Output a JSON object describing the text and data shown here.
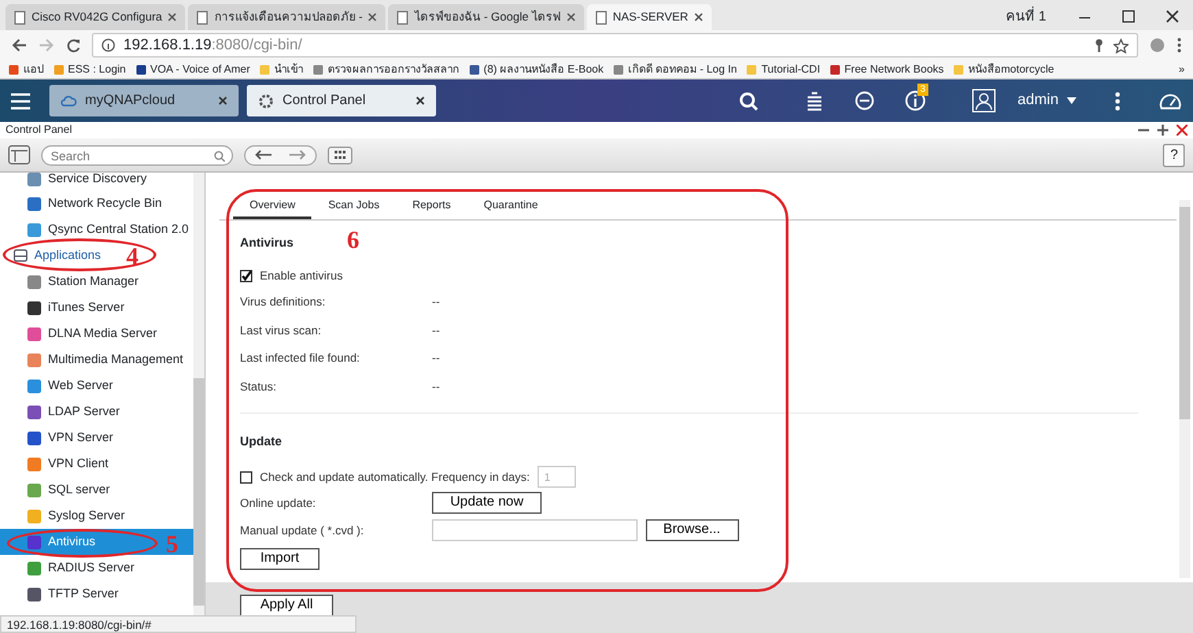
{
  "browser": {
    "tabs": [
      {
        "title": "Cisco RV042G Configura",
        "selected": false
      },
      {
        "title": "การแจ้งเตือนความปลอดภัย -",
        "selected": false
      },
      {
        "title": "ไดรฟ์ของฉัน - Google ไดรฟ",
        "selected": false
      },
      {
        "title": "NAS-SERVER",
        "selected": true
      }
    ],
    "profile": "คนที่ 1",
    "address": {
      "host": "192.168.1.19",
      "rest": ":8080/cgi-bin/"
    },
    "bookmarks": [
      "แอป",
      "ESS : Login",
      "VOA - Voice of Amer",
      "นำเข้า",
      "ตรวจผลการออกรางวัลสลาก",
      "(8) ผลงานหนังสือ E-Book",
      "เกิดดี ดอทคอม - Log In",
      "Tutorial-CDI",
      "Free Network Books",
      "หนังสือmotorcycle"
    ],
    "more_bookmarks": "»",
    "status_url": "192.168.1.19:8080/cgi-bin/#"
  },
  "qnap": {
    "tabs": [
      {
        "title": "myQNAPcloud",
        "selected": false
      },
      {
        "title": "Control Panel",
        "selected": true
      }
    ],
    "notification_count": "3",
    "user": "admin"
  },
  "window": {
    "title": "Control Panel",
    "search": {
      "placeholder": "Search"
    },
    "help": "?"
  },
  "sidebar": {
    "items": [
      {
        "label": "Service Discovery",
        "kind": "item",
        "selected": false
      },
      {
        "label": "Network Recycle Bin",
        "kind": "item",
        "selected": false
      },
      {
        "label": "Qsync Central Station 2.0",
        "kind": "item",
        "selected": false
      },
      {
        "label": "Applications",
        "kind": "group",
        "selected": false
      },
      {
        "label": "Station Manager",
        "kind": "item",
        "selected": false
      },
      {
        "label": "iTunes Server",
        "kind": "item",
        "selected": false
      },
      {
        "label": "DLNA Media Server",
        "kind": "item",
        "selected": false
      },
      {
        "label": "Multimedia Management",
        "kind": "item",
        "selected": false
      },
      {
        "label": "Web Server",
        "kind": "item",
        "selected": false
      },
      {
        "label": "LDAP Server",
        "kind": "item",
        "selected": false
      },
      {
        "label": "VPN Server",
        "kind": "item",
        "selected": false
      },
      {
        "label": "VPN Client",
        "kind": "item",
        "selected": false
      },
      {
        "label": "SQL server",
        "kind": "item",
        "selected": false
      },
      {
        "label": "Syslog Server",
        "kind": "item",
        "selected": false
      },
      {
        "label": "Antivirus",
        "kind": "item",
        "selected": true
      },
      {
        "label": "RADIUS Server",
        "kind": "item",
        "selected": false
      },
      {
        "label": "TFTP Server",
        "kind": "item",
        "selected": false
      }
    ]
  },
  "content": {
    "tabs": [
      {
        "label": "Overview",
        "selected": true
      },
      {
        "label": "Scan Jobs",
        "selected": false
      },
      {
        "label": "Reports",
        "selected": false
      },
      {
        "label": "Quarantine",
        "selected": false
      }
    ],
    "antivirus": {
      "heading": "Antivirus",
      "enable": {
        "label": "Enable antivirus",
        "checked": true
      },
      "rows": [
        {
          "label": "Virus definitions:",
          "value": "--"
        },
        {
          "label": "Last virus scan:",
          "value": "--"
        },
        {
          "label": "Last infected file found:",
          "value": "--"
        },
        {
          "label": "Status:",
          "value": "--"
        }
      ]
    },
    "update": {
      "heading": "Update",
      "auto": {
        "label": "Check and update automatically. Frequency in days:",
        "checked": false,
        "days": "1"
      },
      "online_label": "Online update:",
      "online_button": "Update now",
      "manual_label": "Manual update ( *.cvd ):",
      "browse_button": "Browse...",
      "import_button": "Import"
    },
    "apply_button": "Apply All"
  },
  "annotations": [
    "4",
    "5",
    "6"
  ]
}
